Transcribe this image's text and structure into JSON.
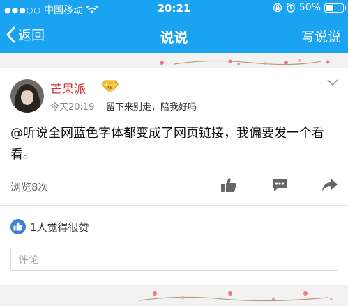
{
  "status_bar": {
    "signal_dots": "●●●○○",
    "carrier": "中国移动",
    "time": "20:21",
    "battery_text": "50%",
    "battery_level": 0.5
  },
  "nav": {
    "back_label": "返回",
    "title": "说说",
    "write_label": "写说说"
  },
  "post": {
    "username": "芒果派",
    "timestamp": "今天20:19",
    "signature": "留下来别走，陪我好吗",
    "content": "@听说全网蓝色字体都变成了网页链接，我偏要发一个看看。",
    "views": "浏览8次",
    "likes": "1人觉得很赞",
    "comment_placeholder": "评论"
  },
  "colors": {
    "header_blue": "#1aa3f0",
    "username_red": "#d0342c",
    "like_blue": "#3b7fd6"
  }
}
